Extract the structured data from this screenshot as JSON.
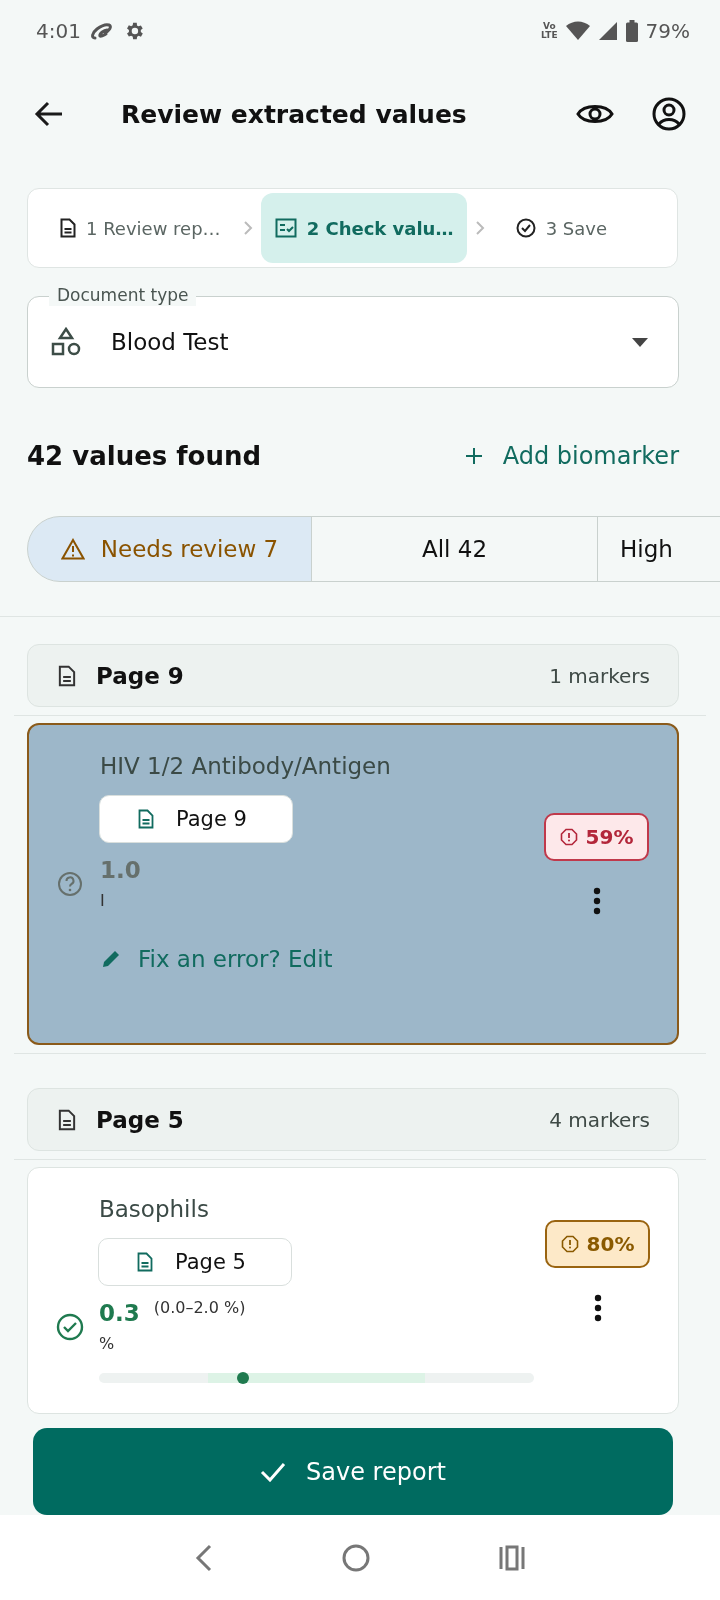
{
  "status_bar": {
    "time": "4:01",
    "volte_lines": [
      "Vo",
      "LTE"
    ],
    "battery": "79%"
  },
  "header": {
    "title": "Review extracted values"
  },
  "steps": [
    {
      "label": "1 Review rep…",
      "kind": "document",
      "selected": false
    },
    {
      "label": "2 Check valu…",
      "kind": "checklist",
      "selected": true
    },
    {
      "label": "3 Save",
      "kind": "check",
      "selected": false
    }
  ],
  "document_type": {
    "label": "Document type",
    "value": "Blood Test"
  },
  "summary": {
    "count": "42 values found",
    "action": "Add biomarker"
  },
  "filters": [
    {
      "label": "Needs review 7",
      "kind": "warning",
      "selected": true
    },
    {
      "label": "All 42",
      "kind": "plain",
      "selected": false
    },
    {
      "label": "High",
      "kind": "plain",
      "selected": false
    }
  ],
  "groups": [
    {
      "page": "Page 9",
      "count": "1 markers",
      "markers": [
        {
          "name": "HIV 1/2 Antibody/Antigen",
          "source": "Page 9",
          "value": "1.0",
          "unit": "I",
          "verified": false,
          "confidence": "59%",
          "confidence_low": true,
          "highlighted": true,
          "edit_link": "Fix an error? Edit"
        }
      ]
    },
    {
      "page": "Page 5",
      "count": "4 markers",
      "markers": [
        {
          "name": "Basophils",
          "source": "Page 5",
          "value": "0.3",
          "range": "(0.0–2.0 %)",
          "unit": "%",
          "verified": true,
          "confidence": "80%",
          "confidence_low": false,
          "highlighted": false,
          "level": 0.33
        }
      ]
    }
  ],
  "save_button": "Save report"
}
